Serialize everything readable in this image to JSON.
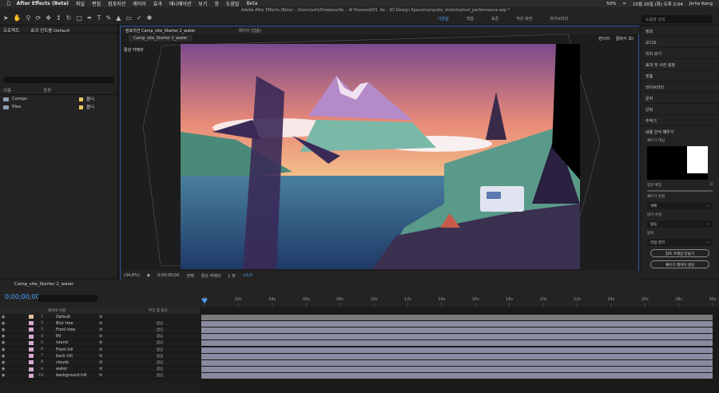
{
  "menubar": {
    "app": "After Effects (Beta)",
    "items": [
      "파일",
      "편집",
      "컴포지션",
      "레이어",
      "효과",
      "애니메이션",
      "보기",
      "창",
      "도움말",
      "Beta"
    ],
    "battery": "50%",
    "datetime": "10월 20일 (화) 오후 2:04",
    "user": "Jinho Kang"
  },
  "window_title": "Adobe After Effects (Beta) - /Users/azhi/Dropbox/Ae... AI Powered/03. Ae - 3D Design Space/campsite_stretchedout_performance.aep *",
  "workspaces": [
    "기본값",
    "학습",
    "표준",
    "작은 화면",
    "라이브러리"
  ],
  "search_placeholder": "도움말 검색",
  "project": {
    "title": "프로젝트",
    "preview_label": "효과 컨트롤 Default",
    "col_name": "이름",
    "col_type": "종류",
    "items": [
      {
        "name": "Comps",
        "type": "폴더"
      },
      {
        "name": "files",
        "type": "폴더"
      }
    ]
  },
  "comp": {
    "tabs": [
      "컴포지션 Camp_site_Starter 2_water",
      "레이어 (없음)"
    ],
    "subtab": "Camp_site_Starter 2_water",
    "camera_label": "활성 카메라",
    "renderer_label": "렌더러:",
    "renderer_value": "클래식 3D",
    "status": [
      "(34.8%)",
      "0;00;00;00",
      "전체",
      "활성 카메라",
      "1 뷰",
      "+0.0"
    ]
  },
  "right_panel": {
    "items": [
      "정보",
      "오디오",
      "미리 보기",
      "효과 및 사전 설정",
      "맞춤",
      "라이브러리",
      "문자",
      "단락",
      "추적기"
    ],
    "fill_title": "내용 인식 채우기",
    "fill_label": "채우기 대상",
    "alpha_label": "알파 확장",
    "alpha_value": "0",
    "fill_method_label": "채우기 방법",
    "fill_method": "개체",
    "range_label": "밝기 수정",
    "range": "없음",
    "range2_label": "범위",
    "range2": "작업 영역",
    "btn1": "참조 프레임 만들기",
    "btn2": "채우기 레이어 생성"
  },
  "timeline": {
    "comp_tab": "Camp_site_Starter 2_water",
    "timecode": "0;00;00;00",
    "col_layer_name": "레이어 이름",
    "col_parent": "부모 및 링크",
    "ticks": [
      "0f",
      "02s",
      "04s",
      "06s",
      "08s",
      "10s",
      "12s",
      "14s",
      "16s",
      "18s",
      "20s",
      "22s",
      "24s",
      "26s",
      "28s",
      "30s"
    ],
    "layers": [
      {
        "num": "1",
        "name": "Default",
        "color": "#e0c0a0",
        "mode": ""
      },
      {
        "num": "2",
        "name": "Blur tree",
        "color": "#d8a8d0",
        "mode": "없음"
      },
      {
        "num": "3",
        "name": "Front tree",
        "color": "#d8a8d0",
        "mode": "없음"
      },
      {
        "num": "4",
        "name": "RV",
        "color": "#d8a8d0",
        "mode": "없음"
      },
      {
        "num": "5",
        "name": "island",
        "color": "#d8a8d0",
        "mode": "없음"
      },
      {
        "num": "6",
        "name": "Front hill",
        "color": "#d8a8d0",
        "mode": "없음"
      },
      {
        "num": "7",
        "name": "back hill",
        "color": "#d8a8d0",
        "mode": "없음"
      },
      {
        "num": "8",
        "name": "clouds",
        "color": "#d8a8d0",
        "mode": "없음"
      },
      {
        "num": "9",
        "name": "water",
        "color": "#d8a8d0",
        "mode": "없음"
      },
      {
        "num": "10",
        "name": "background hill",
        "color": "#d8a8d0",
        "mode": "없음"
      }
    ]
  }
}
